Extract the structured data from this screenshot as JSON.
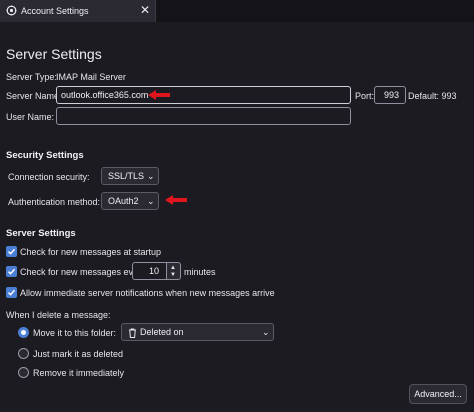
{
  "window": {
    "tab_title": "Account Settings",
    "close_glyph": "✕"
  },
  "page": {
    "title": "Server Settings"
  },
  "server": {
    "type_label": "Server Type:",
    "type_value": "IMAP Mail Server",
    "name_label": "Server Name:",
    "name_value": "outlook.office365.com",
    "port_label": "Port:",
    "port_value": "993",
    "default_label": "Default: 993",
    "user_label": "User Name:",
    "user_value": ""
  },
  "security": {
    "heading": "Security Settings",
    "connection_label": "Connection security:",
    "connection_value": "SSL/TLS",
    "auth_label": "Authentication method:",
    "auth_value": "OAuth2"
  },
  "server_settings": {
    "heading": "Server Settings",
    "check_startup_label": "Check for new messages at startup",
    "check_startup_checked": true,
    "check_every_label": "Check for new messages every",
    "check_every_checked": true,
    "check_every_value": "10",
    "minutes_label": "minutes",
    "immediate_label": "Allow immediate server notifications when new messages arrive",
    "immediate_checked": true
  },
  "delete": {
    "heading": "When I delete a message:",
    "move_label": "Move it to this folder:",
    "move_selected": true,
    "folder_value": "Deleted on",
    "mark_label": "Just mark it as deleted",
    "remove_label": "Remove it immediately"
  },
  "actions": {
    "advanced_label": "Advanced..."
  },
  "colors": {
    "background": "#1c1b22",
    "accent": "#4b7fd6",
    "annotation_arrow": "#e0151d"
  },
  "icons": {
    "tab_icon": "account-settings-gear-icon",
    "chevron": "chevron-down-icon",
    "folder": "trash-folder-icon",
    "annotation": "red-arrow-icon"
  }
}
